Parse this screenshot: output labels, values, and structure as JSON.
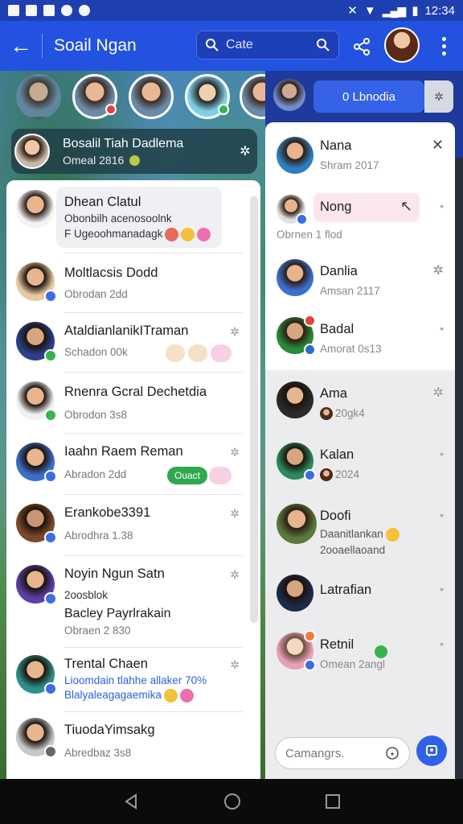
{
  "status_bar": {
    "time": "12:34"
  },
  "app_bar": {
    "title": "Soail Ngan",
    "search_text": "Cate"
  },
  "pinned": {
    "name": "Bosalil Tiah Dadlema",
    "sub": "Omeal 2816"
  },
  "chats": [
    {
      "name": "Dhean Clatul",
      "sub": "Obonbilh acenosoolnk",
      "sub2": "F Ugeoohmanadagk"
    },
    {
      "name": "Moltlacsis Dodd",
      "sub": "Obrodan 2dd"
    },
    {
      "name": "AtaldianlanikITraman",
      "sub": "Schadon 00k"
    },
    {
      "name": "Rnenra Gcral Dechetdia",
      "sub": "Obrodon 3s8"
    },
    {
      "name": "Iaahn Raem Reman",
      "sub": "Abradon 2dd",
      "chip": "Ouact"
    },
    {
      "name": "Erankobe3391",
      "sub": "Abrodhra 1.38"
    },
    {
      "name": "Noyin Ngun Satn",
      "sub": "2oosblok",
      "sub2": "Bacley Payrlrakain",
      "sub3": "Obraen 2 830"
    },
    {
      "name": "Trental Chaen",
      "sub": "Lioomdain tlahhe allaker 70%",
      "sub2": "Blalyaleagagaemika"
    },
    {
      "name": "TiuodaYimsakg",
      "sub": "Abredbaz 3s8"
    }
  ],
  "right_panel": {
    "header_button": "0 Lbnodia",
    "contacts": [
      {
        "name": "Nana",
        "sub": "Shram 2017"
      },
      {
        "name": "Nong",
        "sub": "Obrnen 1 flod"
      },
      {
        "name": "Danlia",
        "sub": "Amsan 2117"
      },
      {
        "name": "Badal",
        "sub": "Amorat 0s13"
      },
      {
        "name": "Ama",
        "sub": "20gk4"
      },
      {
        "name": "Kalan",
        "sub": "2024"
      },
      {
        "name": "Doofi",
        "sub": "Daanitlankan",
        "sub2": "2ooaellaoand"
      },
      {
        "name": "Latrafian"
      },
      {
        "name": "Retnil",
        "sub": "Omean 2angl"
      }
    ],
    "composer_placeholder": "Camangrs."
  },
  "colors": {
    "primary": "#2352e0",
    "accent": "#2f62e6",
    "highlight": "#fbe6ee"
  }
}
